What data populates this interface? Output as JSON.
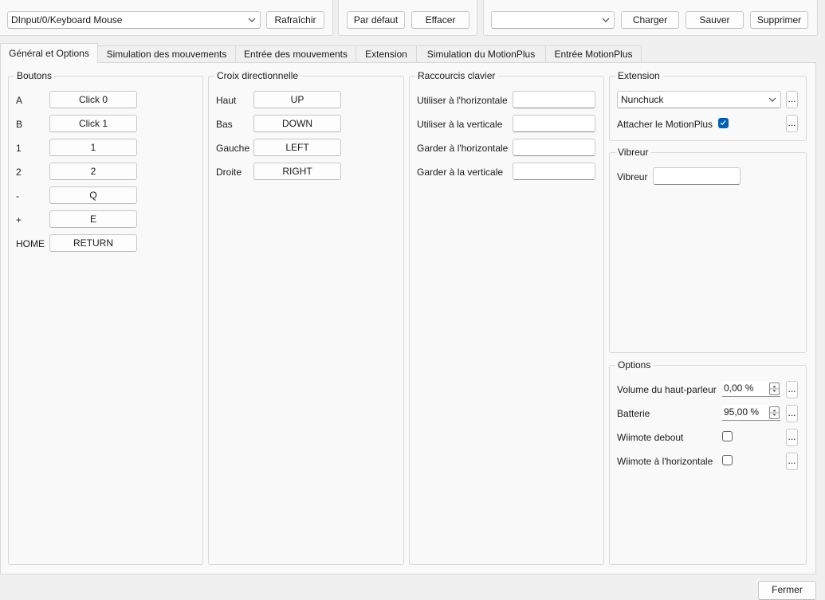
{
  "device": {
    "selected": "DInput/0/Keyboard Mouse",
    "refresh_label": "Rafraîchir"
  },
  "defaults": {
    "default_label": "Par défaut",
    "clear_label": "Effacer"
  },
  "profile": {
    "selected": "",
    "load_label": "Charger",
    "save_label": "Sauver",
    "delete_label": "Supprimer"
  },
  "tabs": [
    {
      "label": "Général et Options"
    },
    {
      "label": "Simulation des mouvements"
    },
    {
      "label": "Entrée des mouvements"
    },
    {
      "label": "Extension"
    },
    {
      "label": "Simulation du MotionPlus"
    },
    {
      "label": "Entrée MotionPlus"
    }
  ],
  "buttons_group": {
    "title": "Boutons",
    "rows": [
      {
        "label": "A",
        "value": "Click 0"
      },
      {
        "label": "B",
        "value": "Click 1"
      },
      {
        "label": "1",
        "value": "1"
      },
      {
        "label": "2",
        "value": "2"
      },
      {
        "label": "-",
        "value": "Q"
      },
      {
        "label": "+",
        "value": "E"
      },
      {
        "label": "HOME",
        "value": "RETURN"
      }
    ]
  },
  "dpad_group": {
    "title": "Croix directionnelle",
    "rows": [
      {
        "label": "Haut",
        "value": "UP"
      },
      {
        "label": "Bas",
        "value": "DOWN"
      },
      {
        "label": "Gauche",
        "value": "LEFT"
      },
      {
        "label": "Droite",
        "value": "RIGHT"
      }
    ]
  },
  "hotkeys_group": {
    "title": "Raccourcis clavier",
    "rows": [
      {
        "label": "Utiliser à l'horizontale",
        "value": ""
      },
      {
        "label": "Utiliser à la verticale",
        "value": ""
      },
      {
        "label": "Garder à l'horizontale",
        "value": ""
      },
      {
        "label": "Garder à la verticale",
        "value": ""
      }
    ]
  },
  "extension_group": {
    "title": "Extension",
    "selected": "Nunchuck",
    "attach_label": "Attacher le MotionPlus",
    "attach_checked": true,
    "more_label": "..."
  },
  "rumble_group": {
    "title": "Vibreur",
    "label": "Vibreur",
    "value": ""
  },
  "options_group": {
    "title": "Options",
    "speaker_label": "Volume du haut-parleur",
    "speaker_value": "0,00 %",
    "battery_label": "Batterie",
    "battery_value": "95,00 %",
    "upright_label": "Wiimote debout",
    "upright_checked": false,
    "sideways_label": "Wiimote à l'horizontale",
    "sideways_checked": false,
    "more_label": "..."
  },
  "footer": {
    "close_label": "Fermer"
  },
  "colors": {
    "accent": "#005fb8",
    "window_bg": "#f0f0f0",
    "panel_bg": "#f9f9f9"
  }
}
